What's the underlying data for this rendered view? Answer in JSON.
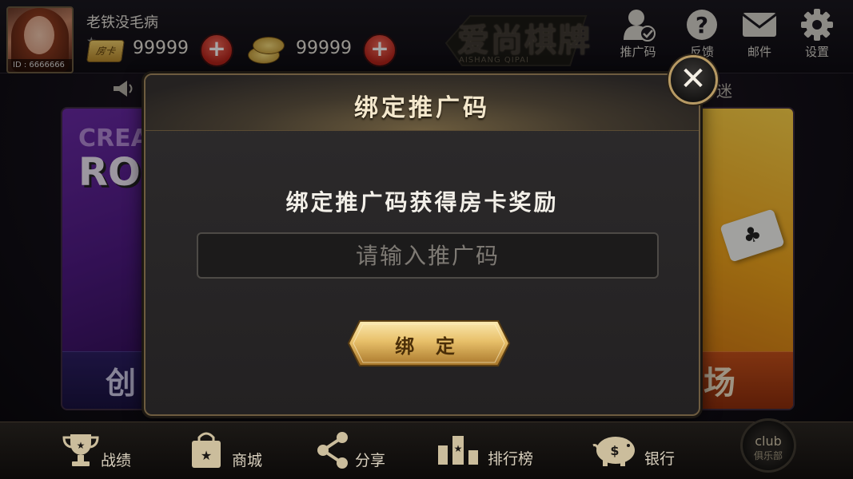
{
  "player": {
    "name": "老铁没毛病",
    "id_label": "ID : 6666666",
    "room_card_label": "房卡",
    "room_cards": "99999",
    "coins": "99999"
  },
  "logo": {
    "title": "爱尚棋牌",
    "subtitle": "AISHANG QIPAI"
  },
  "top_actions": [
    {
      "label": "推广码",
      "icon": "person-check-icon"
    },
    {
      "label": "反馈",
      "icon": "question-icon"
    },
    {
      "label": "邮件",
      "icon": "mail-icon"
    },
    {
      "label": "设置",
      "icon": "gear-icon"
    }
  ],
  "marquee": {
    "visible_tail": "迷"
  },
  "game_cards": {
    "left_title_top": "CREA",
    "left_title_bottom": "RO",
    "left_footer": "创",
    "right_footer": "场"
  },
  "modal": {
    "title": "绑定推广码",
    "subtitle": "绑定推广码获得房卡奖励",
    "input_placeholder": "请输入推广码",
    "input_value": "",
    "bind_button": "绑 定",
    "close_symbol": "✕"
  },
  "bottom_nav": [
    {
      "label": "战绩",
      "icon": "trophy-icon"
    },
    {
      "label": "商城",
      "icon": "shopping-bag-icon"
    },
    {
      "label": "分享",
      "icon": "share-icon"
    },
    {
      "label": "排行榜",
      "icon": "leaderboard-icon"
    },
    {
      "label": "银行",
      "icon": "piggy-bank-icon"
    }
  ],
  "club": {
    "top": "club",
    "bottom": "俱乐部"
  },
  "colors": {
    "gold": "#d8b25a",
    "modal_border": "#6e5c40",
    "plus_red": "#c8302a"
  }
}
